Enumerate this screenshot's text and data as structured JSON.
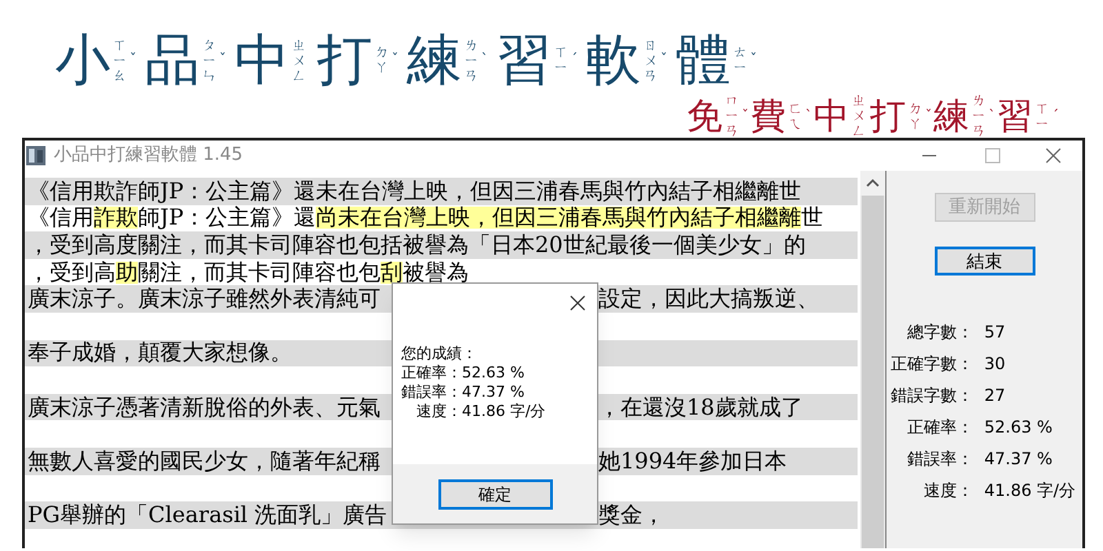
{
  "banner": {
    "title": [
      {
        "char": "小",
        "zhuyin": "ㄒㄧㄠ",
        "tone": "ˇ"
      },
      {
        "char": "品",
        "zhuyin": "ㄆㄧㄣ",
        "tone": "ˇ"
      },
      {
        "char": "中",
        "zhuyin": "ㄓㄨㄥ"
      },
      {
        "char": "打",
        "zhuyin": "ㄉㄚ",
        "tone": "ˇ"
      },
      {
        "char": "練",
        "zhuyin": "ㄌㄧㄢ",
        "tone": "ˋ"
      },
      {
        "char": "習",
        "zhuyin": "ㄒㄧ",
        "tone": "ˊ"
      },
      {
        "char": "軟",
        "zhuyin": "ㄖㄨㄢ",
        "tone": "ˇ"
      },
      {
        "char": "體",
        "zhuyin": "ㄊㄧ",
        "tone": "ˇ"
      }
    ],
    "subtitle": [
      {
        "char": "免",
        "zhuyin": "ㄇㄧㄢ",
        "tone": "ˇ"
      },
      {
        "char": "費",
        "zhuyin": "ㄈㄟ",
        "tone": "ˋ"
      },
      {
        "char": "中",
        "zhuyin": "ㄓㄨㄥ"
      },
      {
        "char": "打",
        "zhuyin": "ㄉㄚ",
        "tone": "ˇ"
      },
      {
        "char": "練",
        "zhuyin": "ㄌㄧㄢ",
        "tone": "ˋ"
      },
      {
        "char": "習",
        "zhuyin": "ㄒㄧ",
        "tone": "ˊ"
      }
    ]
  },
  "window": {
    "title": "小品中打練習軟體 1.45"
  },
  "lines": [
    {
      "kind": "original",
      "text": "《信用欺詐師JP：公主篇》還未在台灣上映，但因三浦春馬與竹內結子相繼離世"
    },
    {
      "kind": "typed",
      "segments": [
        {
          "text": "《信用",
          "error": false
        },
        {
          "text": "詐欺",
          "error": true
        },
        {
          "text": "師JP：公主篇》還",
          "error": false
        },
        {
          "text": "尚未在台灣上映，但因三浦春馬與竹內結子相繼離",
          "error": true
        },
        {
          "text": "世",
          "error": false
        }
      ]
    },
    {
      "kind": "original",
      "text": "，受到高度關注，而其卡司陣容也包括被譽為「日本20世紀最後一個美少女」的"
    },
    {
      "kind": "typed",
      "segments": [
        {
          "text": "，受到高",
          "error": false
        },
        {
          "text": "助",
          "error": true
        },
        {
          "text": "關注，而其卡司陣容也包",
          "error": false
        },
        {
          "text": "刮",
          "error": true
        },
        {
          "text": "被譽為",
          "error": false
        }
      ]
    },
    {
      "kind": "original",
      "text": "廣末涼子。廣末涼子雖然外表清純可",
      "text_after": "設定，因此大搞叛逆、"
    },
    {
      "kind": "blank"
    },
    {
      "kind": "original",
      "text": "奉子成婚，顛覆大家想像。"
    },
    {
      "kind": "blank"
    },
    {
      "kind": "original",
      "text": "廣末涼子憑著清新脫俗的外表、元氣",
      "text_after": "，在還沒18歲就成了"
    },
    {
      "kind": "blank"
    },
    {
      "kind": "original",
      "text": "無數人喜愛的國民少女，隨著年紀稱",
      "text_after": "她1994年參加日本"
    },
    {
      "kind": "blank"
    },
    {
      "kind": "original",
      "text": "PG舉辦的「Clearasil 洗面乳」廣告",
      "text_after": "獎金，"
    },
    {
      "kind": "blank"
    }
  ],
  "buttons": [
    {
      "label": "重新開始",
      "disabled": true,
      "focused": false
    },
    {
      "label": "結束",
      "disabled": false,
      "focused": true
    }
  ],
  "stats": [
    {
      "label": "總字數：",
      "value": "57"
    },
    {
      "label": "正確字數：",
      "value": "30"
    },
    {
      "label": "錯誤字數：",
      "value": "27"
    },
    {
      "label": "正確率：",
      "value": "52.63 %"
    },
    {
      "label": "錯誤率：",
      "value": "47.37 %"
    },
    {
      "label": "速度：",
      "value": "41.86 字/分"
    }
  ],
  "dialog": {
    "heading": "您的成績：",
    "results": [
      {
        "label": "正確率：",
        "value": "52.63 %"
      },
      {
        "label": "錯誤率：",
        "value": "47.37 %"
      },
      {
        "label": "速度：",
        "value": "41.86 字/分"
      }
    ],
    "button": "確定"
  }
}
